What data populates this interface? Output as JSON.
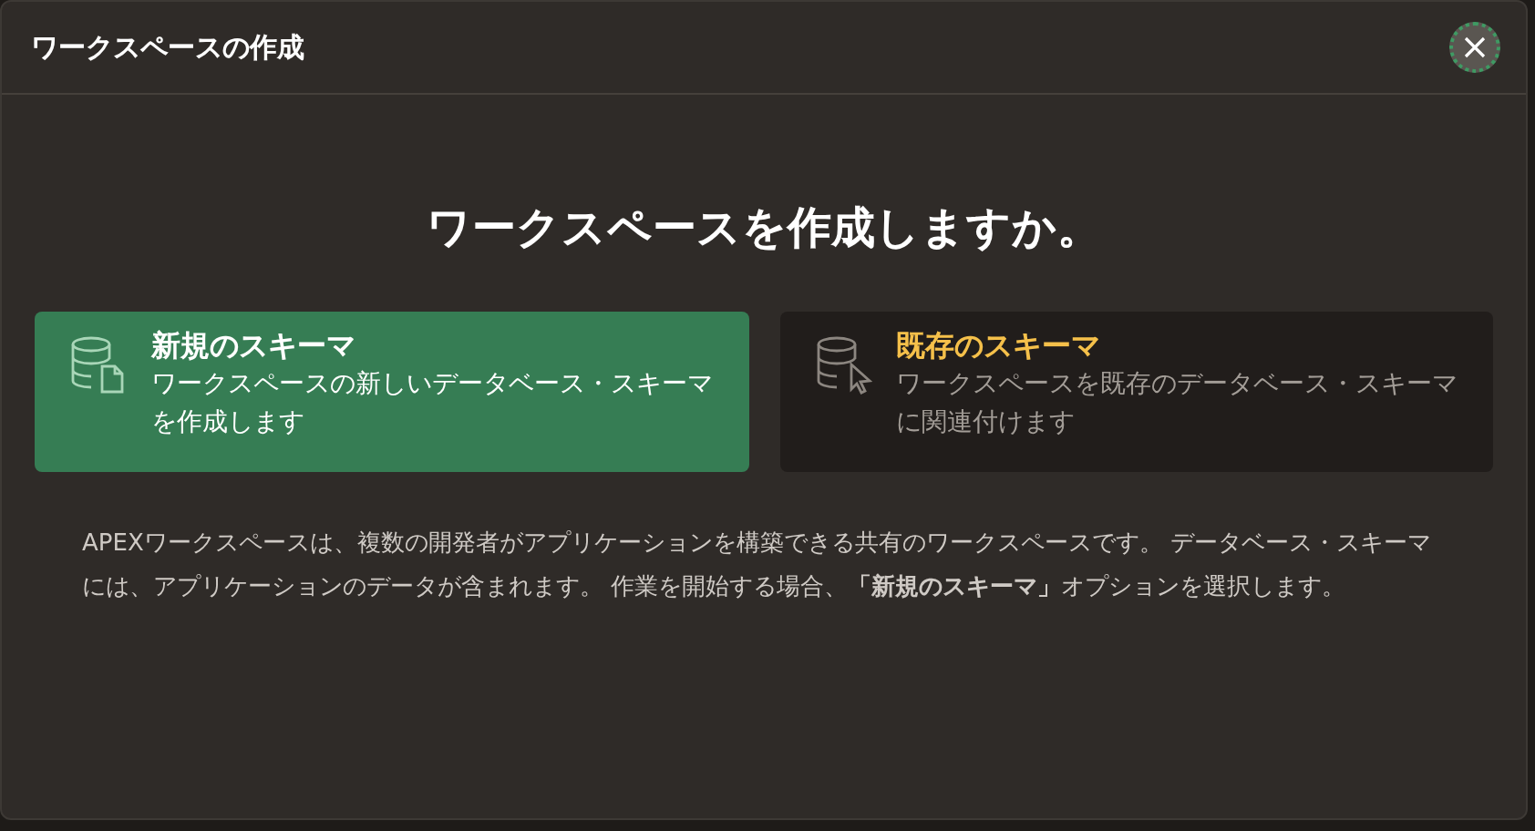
{
  "dialog": {
    "title": "ワークスペースの作成",
    "heading": "ワークスペースを作成しますか。",
    "options": [
      {
        "kind": "new",
        "title": "新規のスキーマ",
        "description": "ワークスペースの新しいデータベース・スキーマを作成します",
        "selected": true
      },
      {
        "kind": "existing",
        "title": "既存のスキーマ",
        "description": "ワークスペースを既存のデータベース・スキーマに関連付けます",
        "selected": false
      }
    ],
    "description": "APEXワークスペースは、複数の開発者がアプリケーションを構築できる共有のワークスペースです。 データベース・スキーマには、アプリケーションのデータが含まれます。 作業を開始する場合、**「新規のスキーマ」**オプションを選択します。"
  }
}
